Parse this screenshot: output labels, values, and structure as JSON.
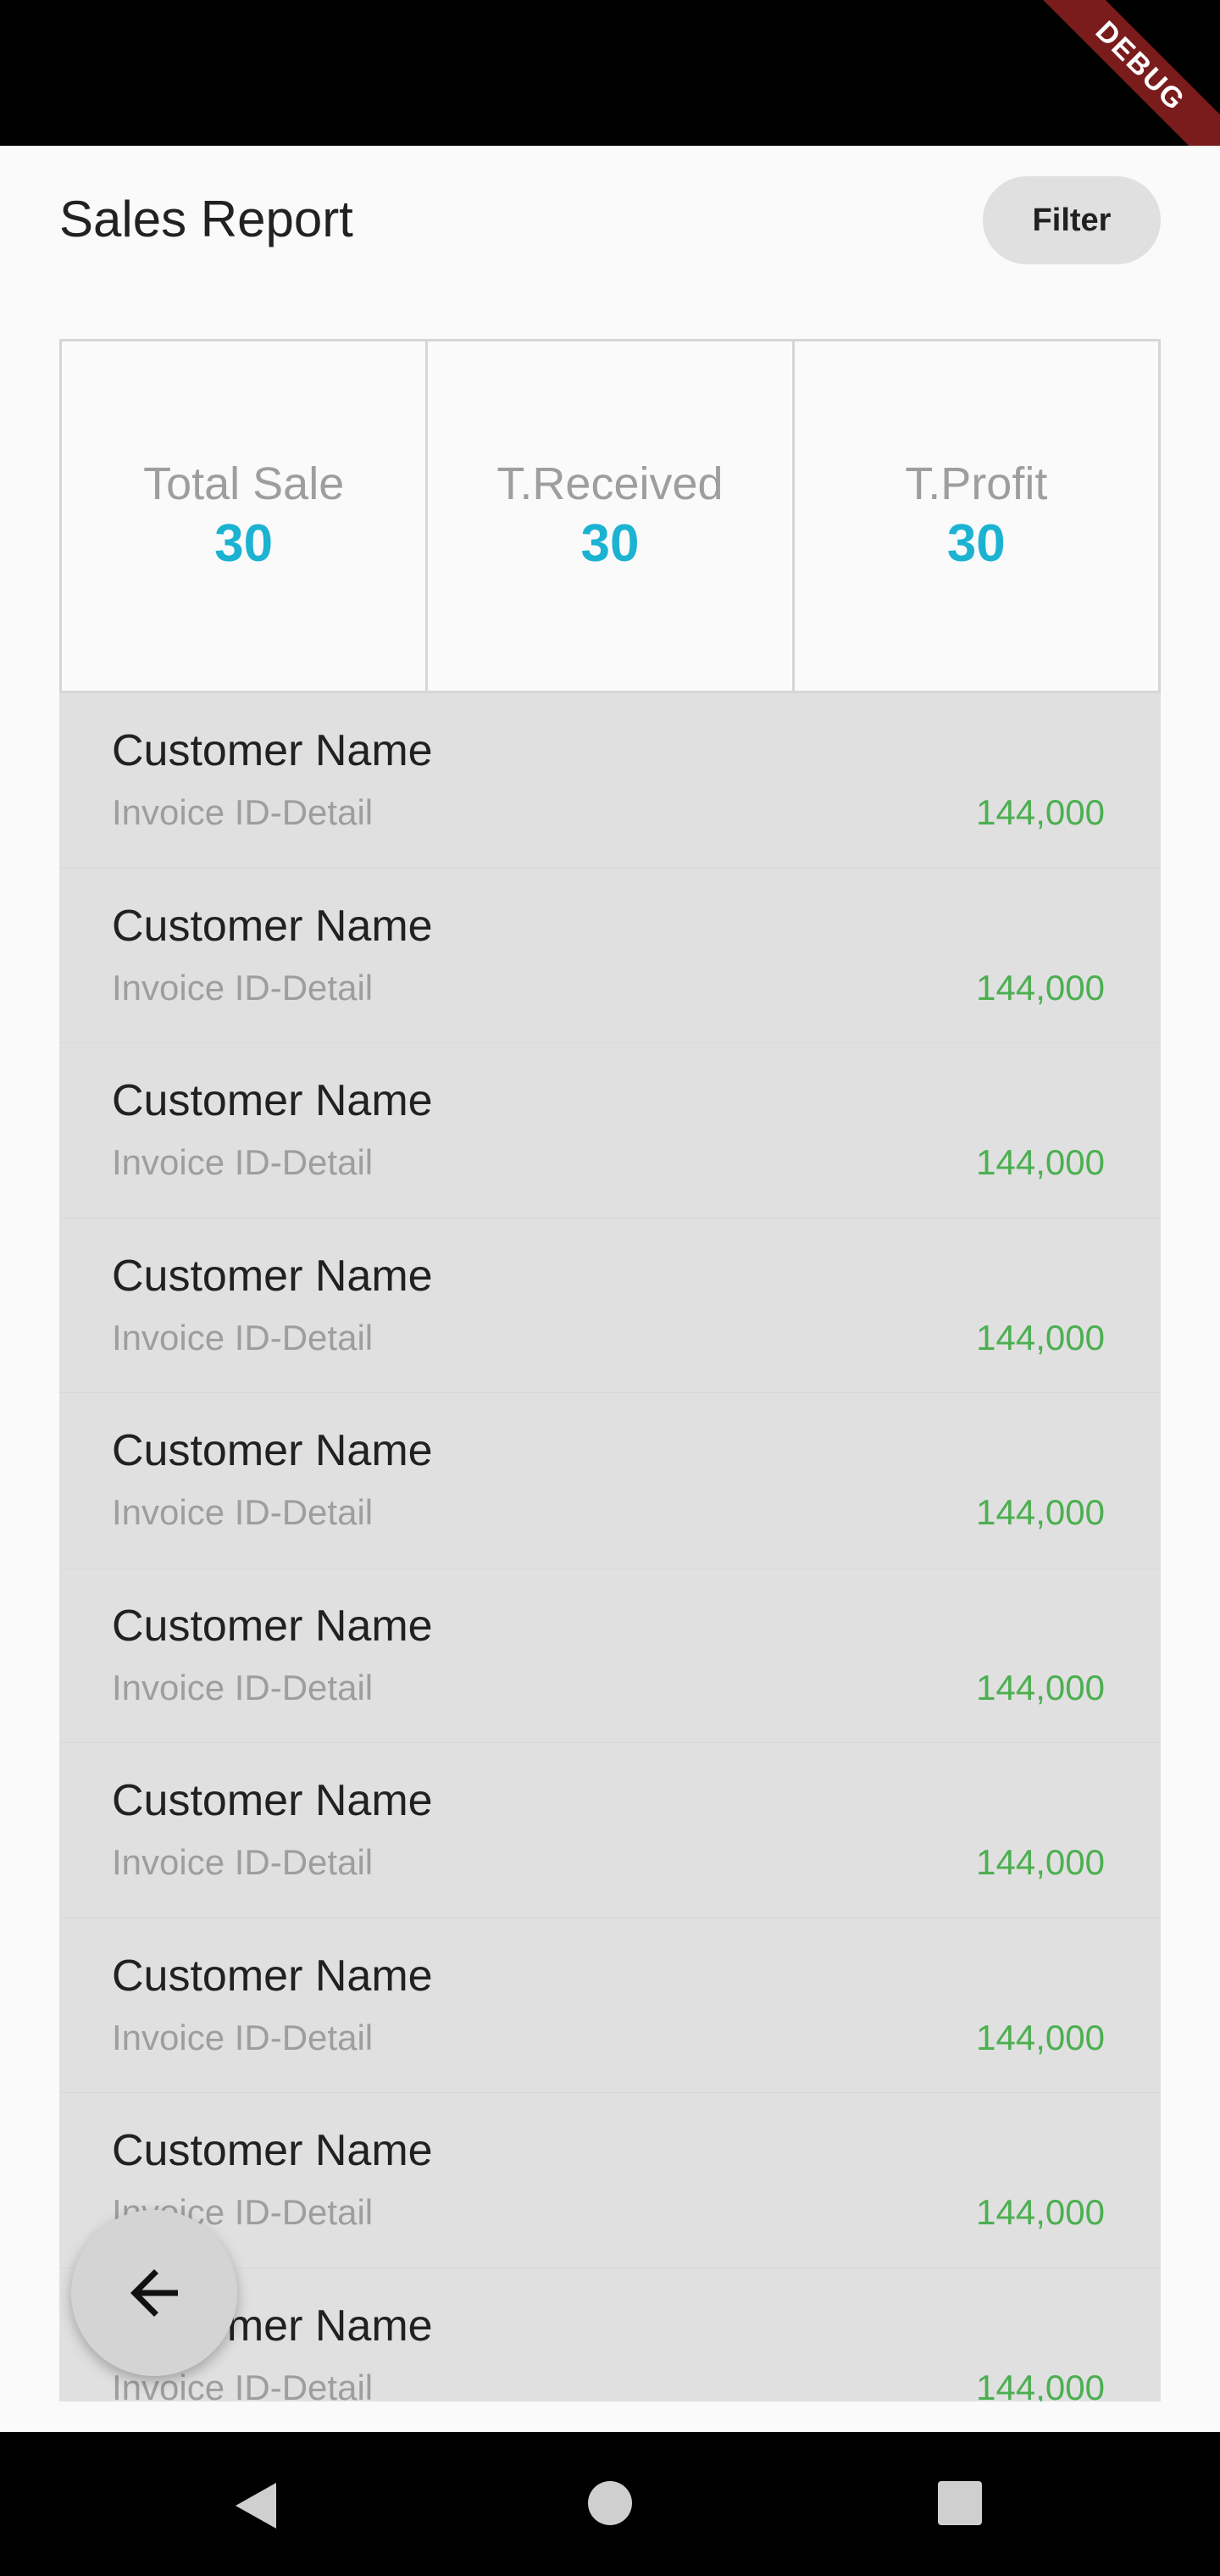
{
  "status_bar": {
    "debug_label": "DEBUG"
  },
  "header": {
    "title": "Sales Report",
    "filter_label": "Filter"
  },
  "summary": [
    {
      "label": "Total Sale",
      "value": "30"
    },
    {
      "label": "T.Received",
      "value": "30"
    },
    {
      "label": "T.Profit",
      "value": "30"
    }
  ],
  "sales": [
    {
      "customer": "Customer Name",
      "invoice": "Invoice ID-Detail",
      "amount": "144,000"
    },
    {
      "customer": "Customer Name",
      "invoice": "Invoice ID-Detail",
      "amount": "144,000"
    },
    {
      "customer": "Customer Name",
      "invoice": "Invoice ID-Detail",
      "amount": "144,000"
    },
    {
      "customer": "Customer Name",
      "invoice": "Invoice ID-Detail",
      "amount": "144,000"
    },
    {
      "customer": "Customer Name",
      "invoice": "Invoice ID-Detail",
      "amount": "144,000"
    },
    {
      "customer": "Customer Name",
      "invoice": "Invoice ID-Detail",
      "amount": "144,000"
    },
    {
      "customer": "Customer Name",
      "invoice": "Invoice ID-Detail",
      "amount": "144,000"
    },
    {
      "customer": "Customer Name",
      "invoice": "Invoice ID-Detail",
      "amount": "144,000"
    },
    {
      "customer": "Customer Name",
      "invoice": "Invoice ID-Detail",
      "amount": "144,000"
    },
    {
      "customer": "Customer Name",
      "invoice": "Invoice ID-Detail",
      "amount": "144,000"
    }
  ],
  "fab": {
    "icon": "arrow-back-icon"
  },
  "colors": {
    "accent": "#1cb3d2",
    "amount": "#4caf50",
    "list_bg": "#e0e0e0",
    "debug_banner": "#7a1c1c"
  }
}
